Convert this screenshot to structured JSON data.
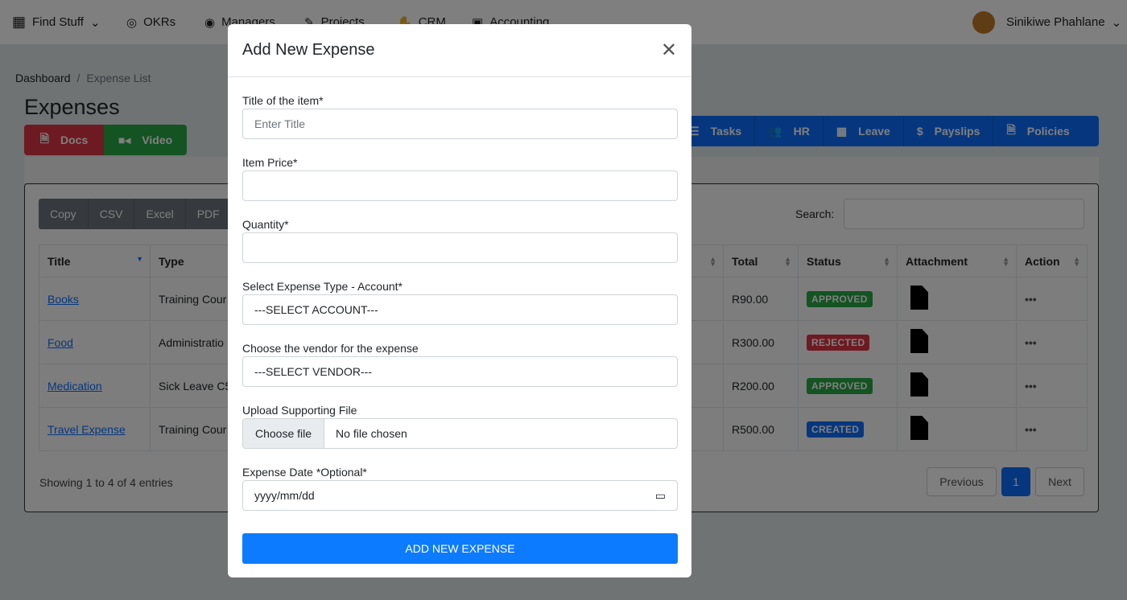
{
  "nav": {
    "items": [
      {
        "label": "Find Stuff",
        "icon": "grid-icon"
      },
      {
        "label": "OKRs",
        "icon": "target-icon"
      },
      {
        "label": "Managers",
        "icon": "user-circle-icon"
      },
      {
        "label": "Projects",
        "icon": "edit-icon"
      },
      {
        "label": "CRM",
        "icon": "handshake-icon"
      },
      {
        "label": "Accounting",
        "icon": "money-icon"
      }
    ],
    "user": "Sinikiwe Phahlane"
  },
  "breadcrumb": {
    "home": "Dashboard",
    "current": "Expense List"
  },
  "page_title": "Expenses",
  "quick": {
    "docs": "Docs",
    "video": "Video"
  },
  "toolbar": [
    "Tasks",
    "HR",
    "Leave",
    "Payslips",
    "Policies"
  ],
  "export": [
    "Copy",
    "CSV",
    "Excel",
    "PDF"
  ],
  "search_label": "Search:",
  "table": {
    "headers": [
      "Title",
      "Type",
      "Total",
      "Status",
      "Attachment",
      "Action"
    ],
    "rows": [
      {
        "title": "Books",
        "type": "Training Cour",
        "total": "R90.00",
        "status": "APPROVED"
      },
      {
        "title": "Food",
        "type": "Administratio",
        "total": "R300.00",
        "status": "REJECTED"
      },
      {
        "title": "Medication",
        "type": "Sick Leave C5",
        "total": "R200.00",
        "status": "APPROVED"
      },
      {
        "title": "Travel Expense",
        "type": "Training Cour",
        "total": "R500.00",
        "status": "CREATED"
      }
    ]
  },
  "status_colors": {
    "APPROVED": "#28a745",
    "REJECTED": "#dc3545",
    "CREATED": "#0d6efd"
  },
  "info": "Showing 1 to 4 of 4 entries",
  "pagination": {
    "prev": "Previous",
    "page": "1",
    "next": "Next"
  },
  "modal": {
    "title": "Add New Expense",
    "title_label": "Title of the item*",
    "title_placeholder": "Enter Title",
    "price_label": "Item Price*",
    "qty_label": "Quantity*",
    "account_label": "Select Expense Type - Account*",
    "account_value": "---SELECT ACCOUNT---",
    "vendor_label": "Choose the vendor for the expense",
    "vendor_value": "---SELECT VENDOR---",
    "file_label": "Upload Supporting File",
    "file_button": "Choose file",
    "file_status": "No file chosen",
    "date_label": "Expense Date *Optional*",
    "date_placeholder": "yyyy/mm/dd",
    "submit": "ADD NEW EXPENSE"
  }
}
